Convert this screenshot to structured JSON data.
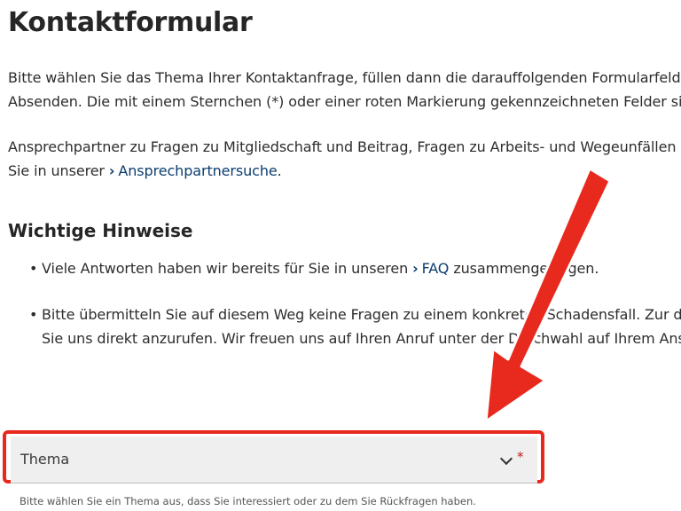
{
  "header": {
    "title": "Kontaktformular"
  },
  "intro": {
    "line1": "Bitte wählen Sie das Thema Ihrer Kontaktanfrage, füllen dann die darauffolgenden Formularfelder aus u",
    "line2": "Absenden. Die mit einem Sternchen (*) oder einer roten Markierung gekennzeichneten Felder sind Pflic"
  },
  "contact_info": {
    "line1": "Ansprechpartner zu Fragen zu Mitgliedschaft und Beitrag, Fragen zu Arbeits- und Wegeunfällen und zur",
    "line2_prefix": "Sie in unserer",
    "link_label": "Ansprechpartnersuche",
    "line2_suffix": "."
  },
  "notes": {
    "heading": "Wichtige Hinweise",
    "item1": {
      "prefix": "Viele Antworten haben wir bereits für Sie in unseren",
      "link_label": "FAQ",
      "suffix": "zusammengetragen."
    },
    "item2": {
      "line1": "Bitte übermitteln Sie auf diesem Weg keine Fragen zu einem konkreten Schadensfall. Zur direkten",
      "line2": "Sie uns direkt anzurufen. Wir freuen uns auf Ihren Anruf unter der Durchwahl auf Ihrem Anschreib"
    }
  },
  "form": {
    "topic_select": {
      "value": "Thema",
      "required_marker": "*",
      "helper_text": "Bitte wählen Sie ein Thema aus, dass Sie interessiert oder zu dem Sie Rückfragen haben."
    }
  },
  "icons": {
    "link_chevron": "chevron-right-icon",
    "select_chevron": "chevron-down-icon"
  },
  "colors": {
    "link": "#0b3d6e",
    "highlight": "#e8291d",
    "required": "#c21c1c",
    "select_bg": "#efefef"
  }
}
